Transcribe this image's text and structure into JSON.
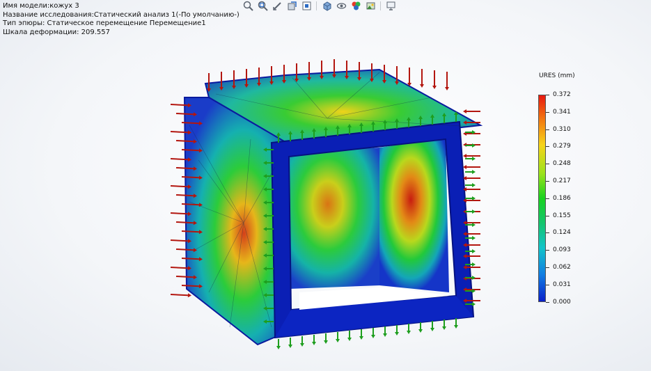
{
  "info": {
    "model_name": "Имя модели:кожух 3",
    "study_name": "Название исследования:Статический анализ 1(-По умолчанию-)",
    "plot_type": "Тип эпюры: Статическое перемещение Перемещение1",
    "deform_scale": "Шкала деформации: 209.557"
  },
  "toolbar": {
    "icons": [
      "zoom-to-fit-icon",
      "zoom-area-icon",
      "previous-view-icon",
      "section-view-icon",
      "view-orientation-icon",
      "display-style-icon",
      "hide-show-icon",
      "edit-appearance-icon",
      "apply-scene-icon",
      "view-settings-icon"
    ]
  },
  "legend": {
    "title": "URES (mm)",
    "labels": [
      "0.372",
      "0.341",
      "0.310",
      "0.279",
      "0.248",
      "0.217",
      "0.186",
      "0.155",
      "0.124",
      "0.093",
      "0.062",
      "0.031",
      "0.000"
    ],
    "colors": {
      "max": "#e8190f",
      "mid": "#18d21f",
      "min": "#0a1fc9"
    }
  },
  "model": {
    "load_arrow_color": "#b3160f",
    "fixture_arrow_color": "#1e9e1e",
    "edge_color": "#0a1a9e"
  }
}
